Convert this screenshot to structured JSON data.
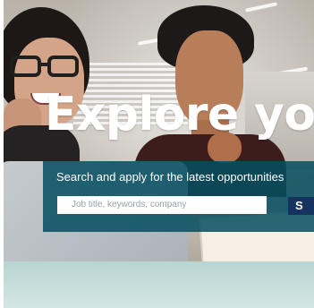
{
  "hero": {
    "headline": "Explore your",
    "search_prompt": "Search and apply for the latest opportunities"
  },
  "search": {
    "placeholder": "Job title, keywords, company",
    "button_label": "S"
  },
  "colors": {
    "panel": "#054e61",
    "button": "#16325f",
    "text_on_dark": "#ffffff"
  }
}
